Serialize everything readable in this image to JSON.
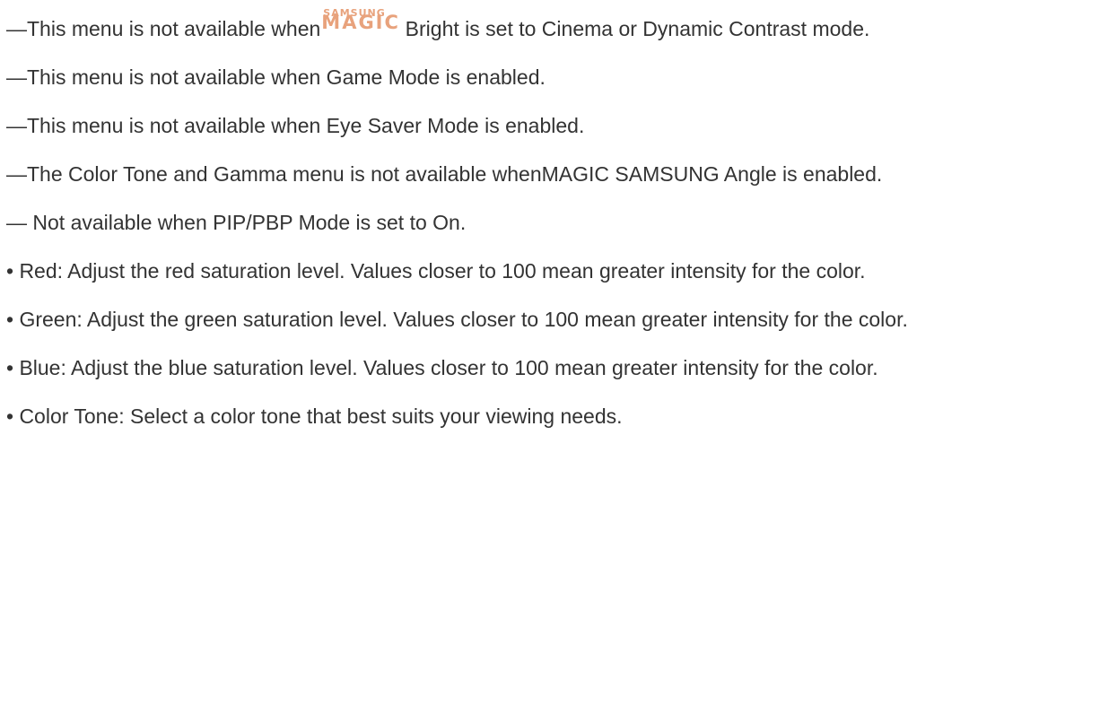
{
  "paragraphs": {
    "p1": {
      "before_logo": "—This menu is not available when",
      "logo_top": "SAMSUNG",
      "logo_main": "MAGIC",
      "after_logo": " Bright is set to Cinema or Dynamic Contrast mode."
    },
    "p2": "—This menu is not available when Game Mode is enabled.",
    "p3": "—This menu is not available when Eye Saver Mode is enabled.",
    "p4": "—The Color Tone and Gamma menu is not available whenMAGIC SAMSUNG Angle is enabled.",
    "p5": "— Not available when PIP/PBP Mode is set to On.",
    "p6": "• Red: Adjust the red saturation level. Values closer to 100 mean greater intensity for the color.",
    "p7": "• Green: Adjust the green saturation level. Values closer to 100 mean greater intensity for the color.",
    "p8": "• Blue: Adjust the blue saturation level. Values closer to 100 mean greater intensity for the color.",
    "p9": "• Color Tone: Select a color tone that best suits your viewing needs."
  },
  "colors": {
    "text": "#333333",
    "logo": "#e8a27c",
    "background": "#ffffff"
  }
}
